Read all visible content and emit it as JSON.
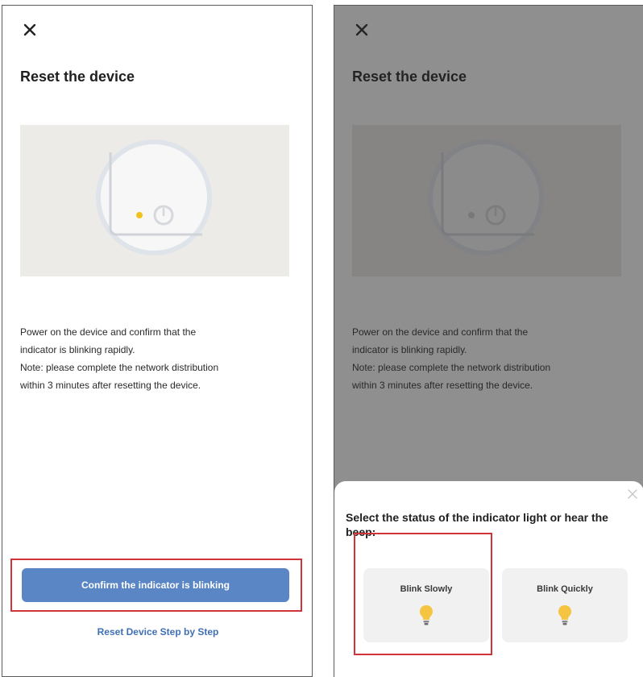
{
  "left_screen": {
    "close_icon": "close-icon",
    "title": "Reset the device",
    "illustration_icon": "device-reset-illustration",
    "description_lines": [
      "Power on the device and confirm that the",
      "indicator is blinking rapidly.",
      "Note: please complete the network distribution",
      "within 3 minutes after resetting the device."
    ],
    "confirm_button_label": "Confirm the indicator is blinking",
    "step_link_label": "Reset Device Step by Step"
  },
  "right_screen": {
    "close_icon": "close-icon",
    "title": "Reset the device",
    "description_lines": [
      "Power on the device and confirm that the",
      "indicator is blinking rapidly.",
      "Note: please complete the network distribution",
      "within 3 minutes after resetting the device."
    ],
    "sheet": {
      "close_icon": "close-icon",
      "title": "Select the status of the indicator light or hear the beep:",
      "options": [
        {
          "label": "Blink Slowly",
          "icon": "lightbulb-icon"
        },
        {
          "label": "Blink Quickly",
          "icon": "lightbulb-icon"
        }
      ]
    }
  },
  "colors": {
    "primary": "#5a86c6",
    "link": "#3f6fb6",
    "highlight": "#d0333a",
    "indicator": "#f2c21b",
    "bulb": "#f5c542"
  }
}
